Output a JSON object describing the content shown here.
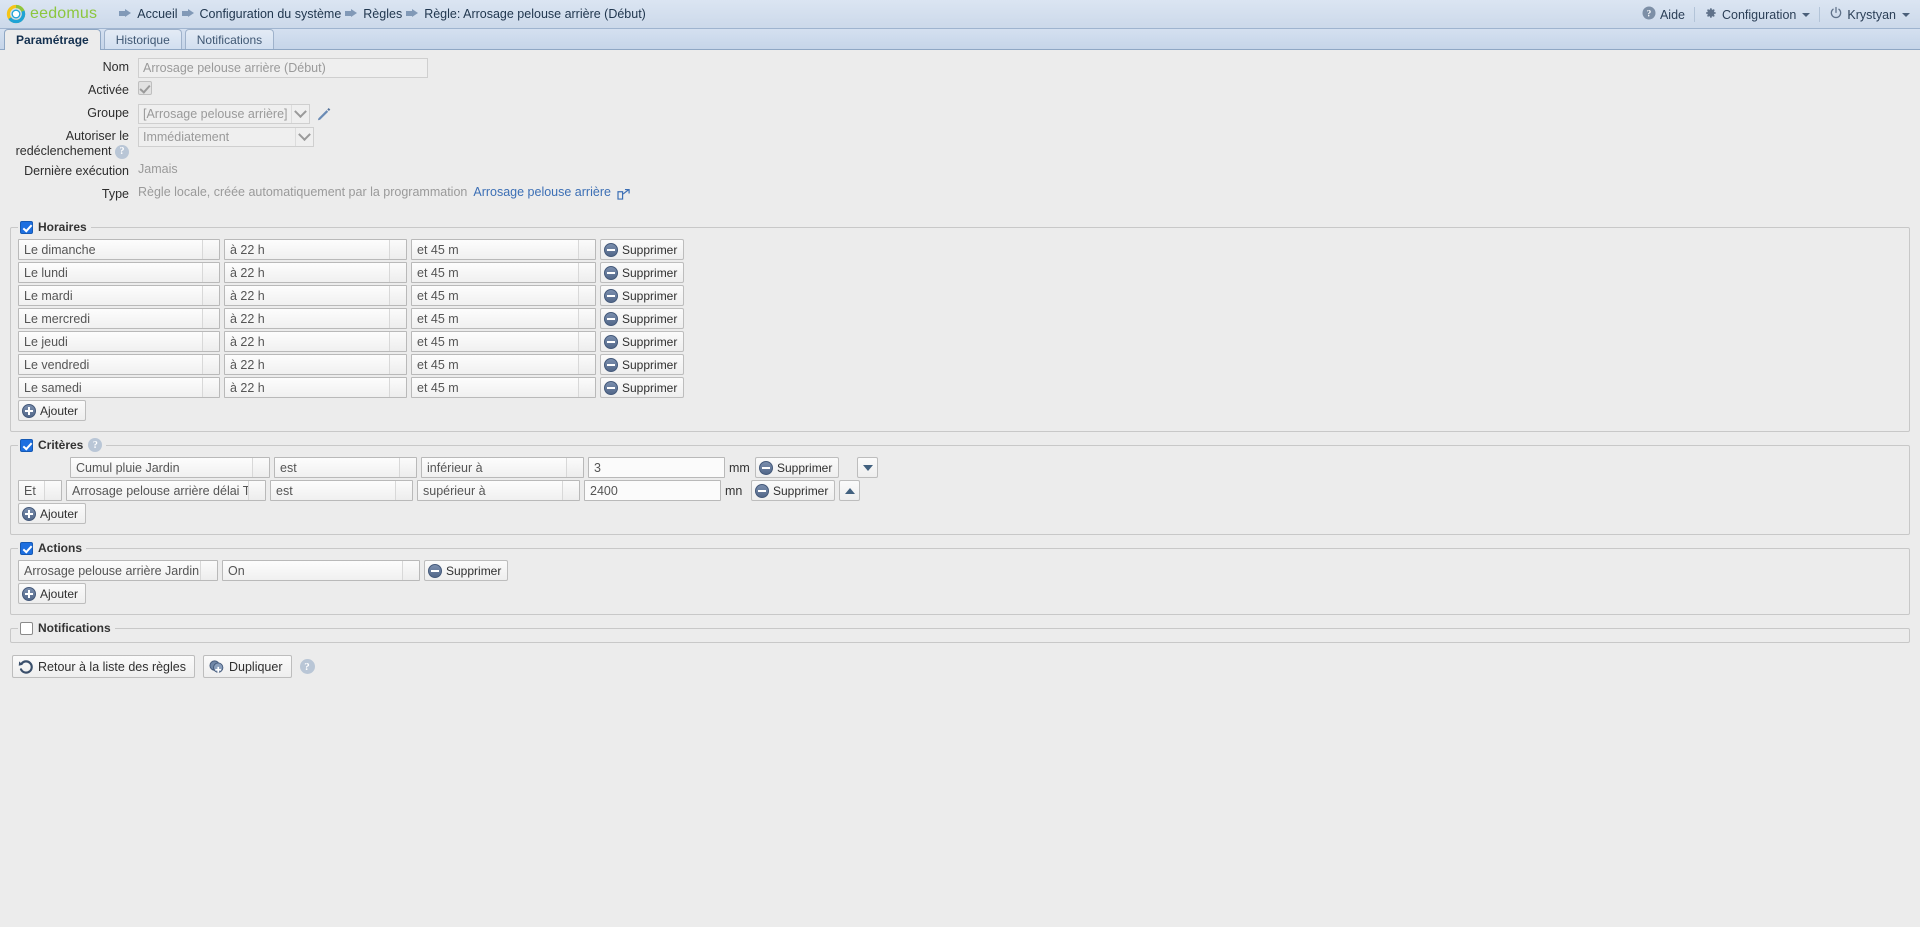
{
  "header": {
    "brand": "eedomus",
    "breadcrumbs": [
      {
        "label": "Accueil"
      },
      {
        "label": "Configuration du système"
      },
      {
        "label": "Règles"
      },
      {
        "label": "Règle: Arrosage pelouse arrière (Début)"
      }
    ],
    "help_label": "Aide",
    "config_label": "Configuration",
    "user_label": "Krystyan"
  },
  "tabs": [
    {
      "label": "Paramétrage",
      "active": true
    },
    {
      "label": "Historique",
      "active": false
    },
    {
      "label": "Notifications",
      "active": false
    }
  ],
  "form": {
    "nom_label": "Nom",
    "nom_value": "Arrosage pelouse arrière (Début)",
    "activee_label": "Activée",
    "groupe_label": "Groupe",
    "groupe_value": "[Arrosage pelouse arrière]",
    "redecl_label_1": "Autoriser le",
    "redecl_label_2": "redéclenchement",
    "redecl_value": "Immédiatement",
    "derniere_label": "Dernière exécution",
    "derniere_value": "Jamais",
    "type_label": "Type",
    "type_value": "Règle locale, créée automatiquement par la programmation",
    "type_link": "Arrosage pelouse arrière"
  },
  "horaires": {
    "legend": "Horaires",
    "rows": [
      {
        "day": "Le dimanche",
        "hour": "à 22 h",
        "minute": "et 45 m",
        "delete": "Supprimer"
      },
      {
        "day": "Le lundi",
        "hour": "à 22 h",
        "minute": "et 45 m",
        "delete": "Supprimer"
      },
      {
        "day": "Le mardi",
        "hour": "à 22 h",
        "minute": "et 45 m",
        "delete": "Supprimer"
      },
      {
        "day": "Le mercredi",
        "hour": "à 22 h",
        "minute": "et 45 m",
        "delete": "Supprimer"
      },
      {
        "day": "Le jeudi",
        "hour": "à 22 h",
        "minute": "et 45 m",
        "delete": "Supprimer"
      },
      {
        "day": "Le vendredi",
        "hour": "à 22 h",
        "minute": "et 45 m",
        "delete": "Supprimer"
      },
      {
        "day": "Le samedi",
        "hour": "à 22 h",
        "minute": "et 45 m",
        "delete": "Supprimer"
      }
    ],
    "add": "Ajouter"
  },
  "criteres": {
    "legend": "Critères",
    "rows": [
      {
        "conj": "",
        "source": "Cumul pluie Jardin",
        "op": "est",
        "cmp": "inférieur à",
        "value": "3",
        "unit": "mm",
        "delete": "Supprimer",
        "move": "down"
      },
      {
        "conj": "Et",
        "source": "Arrosage pelouse arrière délai Test",
        "op": "est",
        "cmp": "supérieur à",
        "value": "2400",
        "unit": "mn",
        "delete": "Supprimer",
        "move": "up"
      }
    ],
    "add": "Ajouter"
  },
  "actions": {
    "legend": "Actions",
    "rows": [
      {
        "device": "Arrosage pelouse arrière Jardin",
        "value": "On",
        "delete": "Supprimer"
      }
    ],
    "add": "Ajouter"
  },
  "notifications": {
    "legend": "Notifications"
  },
  "footer": {
    "back_label": "Retour à la liste des règles",
    "duplicate_label": "Dupliquer"
  },
  "colors": {
    "accent": "#3c6fb5",
    "brand_green": "#8cc63e",
    "checkbox_blue": "#1d6fe0",
    "header_bg": "#d3dfee",
    "page_bg": "#ececec"
  }
}
